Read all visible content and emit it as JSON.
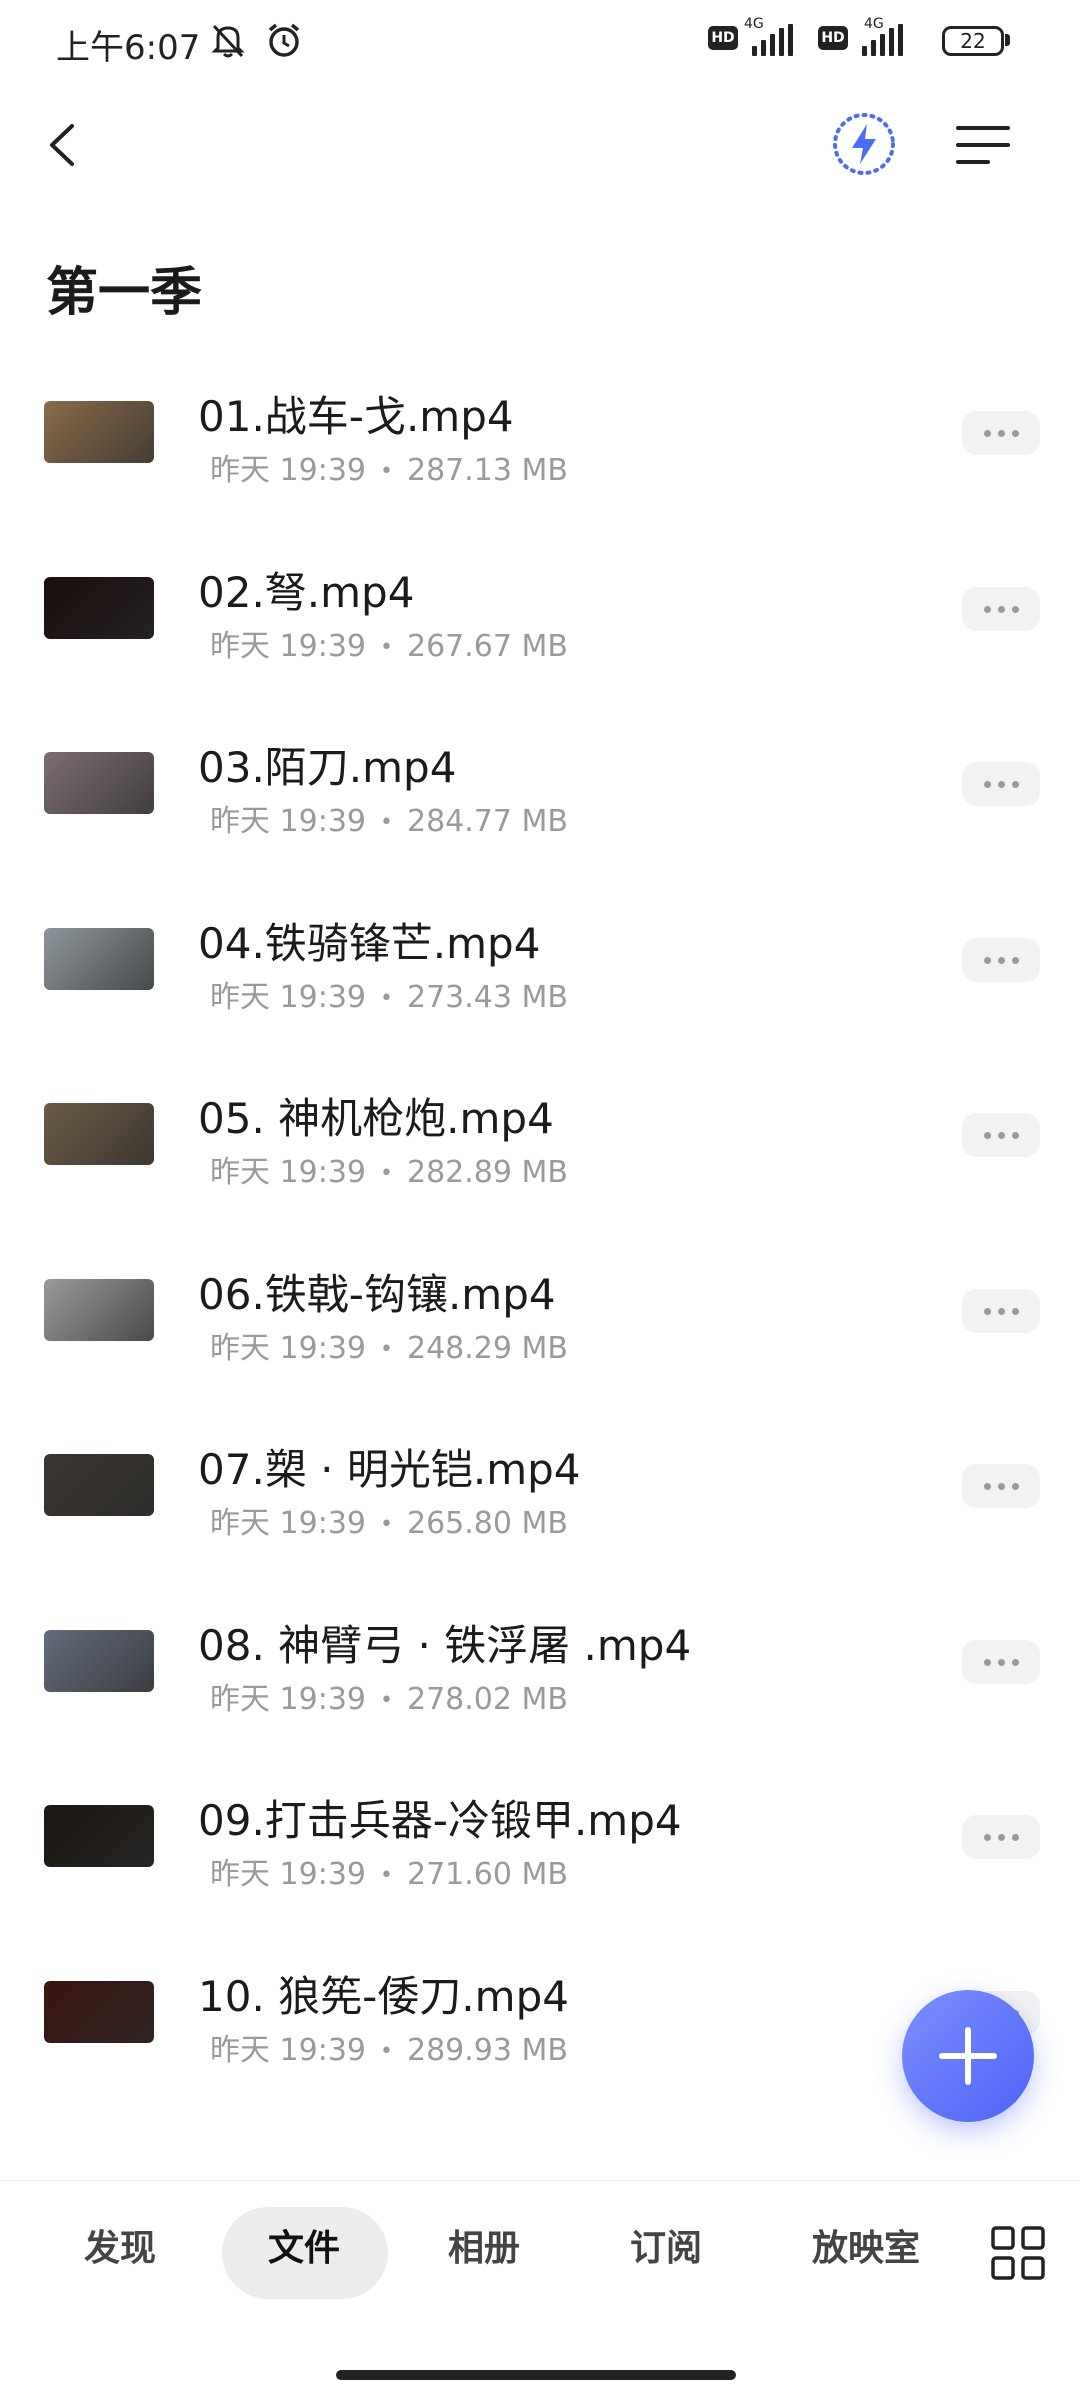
{
  "status_bar": {
    "time": "上午6:07",
    "network_1": "4G",
    "network_2": "4G",
    "hd_label": "HD",
    "battery": "22",
    "icons": [
      "mute-bell-icon",
      "alarm-clock-icon",
      "signal-icon",
      "battery-icon"
    ]
  },
  "top_bar": {
    "back_icon": "chevron-left-icon",
    "speed_icon": "lightning-icon",
    "menu_icon": "sort-menu-icon",
    "accent_color": "#4d6bf5"
  },
  "page": {
    "title": "第一季"
  },
  "files": [
    {
      "name": "01.战车-戈.mp4",
      "time": "昨天 19:39",
      "size": "287.13 MB",
      "thumb_color": "#8a6b4a"
    },
    {
      "name": "02.弩.mp4",
      "time": "昨天 19:39",
      "size": "267.67 MB",
      "thumb_color": "#1a0d0d"
    },
    {
      "name": "03.陌刀.mp4",
      "time": "昨天 19:39",
      "size": "284.77 MB",
      "thumb_color": "#7b6d74"
    },
    {
      "name": "04.铁骑锋芒.mp4",
      "time": "昨天 19:39",
      "size": "273.43 MB",
      "thumb_color": "#8f979c"
    },
    {
      "name": "05. 神机枪炮.mp4",
      "time": "昨天 19:39",
      "size": "282.89 MB",
      "thumb_color": "#6b5a45"
    },
    {
      "name": "06.铁戟-钩镶.mp4",
      "time": "昨天 19:39",
      "size": "248.29 MB",
      "thumb_color": "#9a9a98"
    },
    {
      "name": "07.槊 · 明光铠.mp4",
      "time": "昨天 19:39",
      "size": "265.80 MB",
      "thumb_color": "#3a3530"
    },
    {
      "name": "08. 神臂弓 · 铁浮屠 .mp4",
      "time": "昨天 19:39",
      "size": "278.02 MB",
      "thumb_color": "#646c7c"
    },
    {
      "name": "09.打击兵器-冷锻甲.mp4",
      "time": "昨天 19:39",
      "size": "271.60 MB",
      "thumb_color": "#1c1712"
    },
    {
      "name": "10. 狼筅-倭刀.mp4",
      "time": "昨天 19:39",
      "size": "289.93 MB",
      "thumb_color": "#3a1410"
    }
  ],
  "fab": {
    "icon": "plus-icon"
  },
  "bottom_nav": {
    "items": [
      "发现",
      "文件",
      "相册",
      "订阅",
      "放映室"
    ],
    "active": "文件",
    "grid_icon": "apps-grid-icon"
  }
}
